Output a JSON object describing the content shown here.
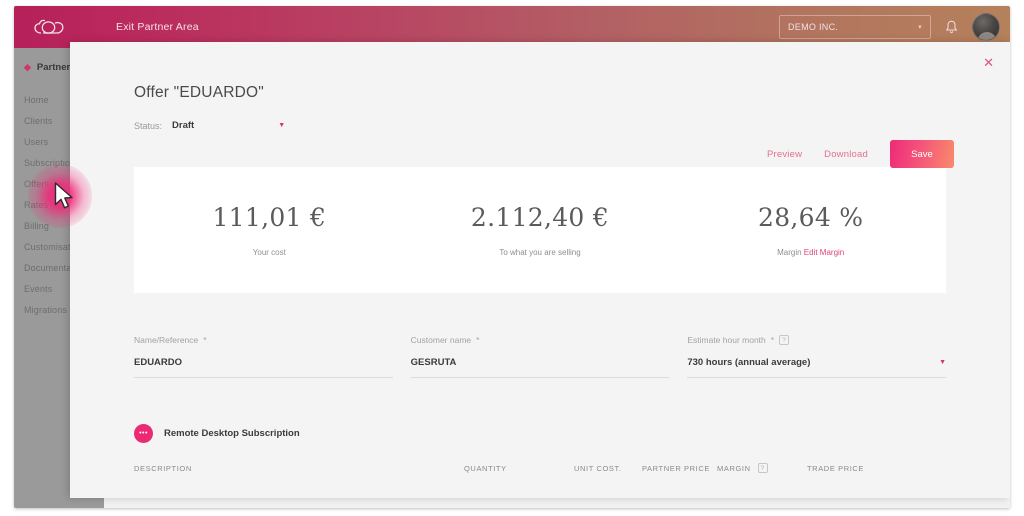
{
  "topbar": {
    "logo_icon": "cloud-logo-icon",
    "exit_label": "Exit Partner Area",
    "org_name": "DEMO INC.",
    "caret": "▾",
    "bell_icon": "notification-bell-icon",
    "avatar_icon": "user-avatar"
  },
  "sidebar": {
    "partner_label": "Partner",
    "items": [
      {
        "label": "Home"
      },
      {
        "label": "Clients"
      },
      {
        "label": "Users"
      },
      {
        "label": "Subscriptions"
      },
      {
        "label": "Offers"
      },
      {
        "label": "Rates"
      },
      {
        "label": "Billing"
      },
      {
        "label": "Customisation"
      },
      {
        "label": "Documentation"
      },
      {
        "label": "Events"
      },
      {
        "label": "Migrations"
      }
    ]
  },
  "modal": {
    "close_label": "✕",
    "title": "Offer \"EDUARDO\"",
    "status_label": "Status:",
    "status_value": "Draft",
    "status_caret": "▼",
    "actions": {
      "preview_label": "Preview",
      "download_label": "Download",
      "save_label": "Save"
    },
    "stats": [
      {
        "value": "111,01 €",
        "label": "Your cost",
        "link": ""
      },
      {
        "value": "2.112,40 €",
        "label": "To what you are selling",
        "link": ""
      },
      {
        "value": "28,64 %",
        "label": "Margin",
        "link": "Edit Margin"
      }
    ],
    "fields": [
      {
        "label": "Name/Reference",
        "required": "*",
        "value": "EDUARDO",
        "has_help": false,
        "has_caret": false
      },
      {
        "label": "Customer name",
        "required": "*",
        "value": "GESRUTA",
        "has_help": false,
        "has_caret": false
      },
      {
        "label": "Estimate hour month",
        "required": "*",
        "value": "730 hours (annual average)",
        "has_help": true,
        "help_label": "?",
        "has_caret": true,
        "caret": "▼"
      }
    ],
    "product": {
      "icon_label": "•••",
      "name": "Remote Desktop Subscription"
    },
    "table_headers": {
      "description": "DESCRIPTION",
      "quantity": "QUANTITY",
      "unit_cost": "UNIT COST.",
      "partner_price": "PARTNER PRICE",
      "margin": "MARGIN",
      "margin_help": "?",
      "trade_price": "TRADE PRICE"
    }
  },
  "colors": {
    "brand_pink": "#ec2a73",
    "brand_crimson": "#b5205a",
    "brand_orange": "#b5815c",
    "link_pink": "#e0437b"
  }
}
